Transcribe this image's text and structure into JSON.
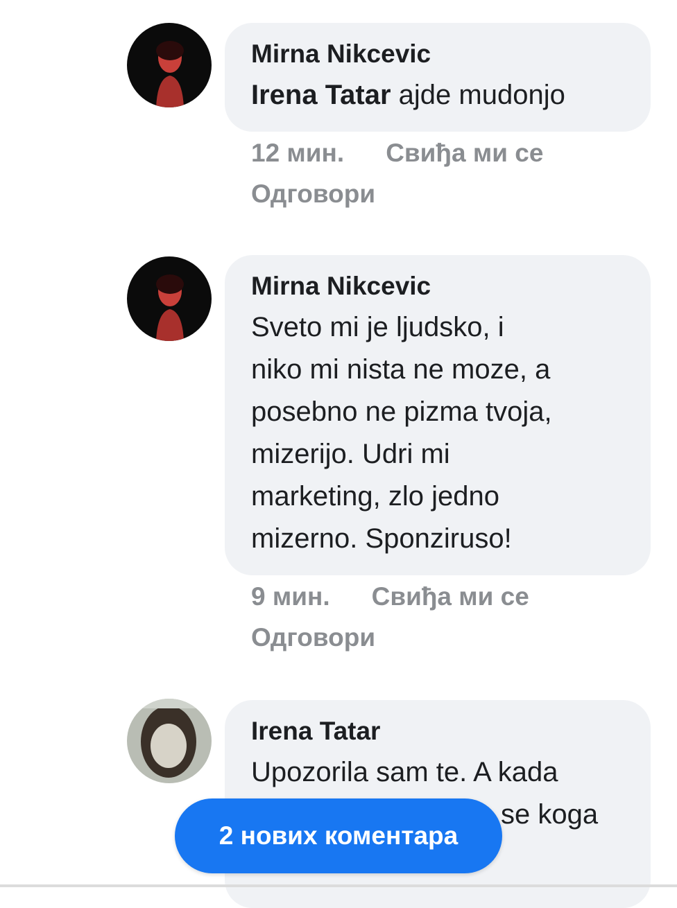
{
  "comments": [
    {
      "author": "Mirna Nikcevic",
      "mention": "Irena Tatar",
      "text": " ajde mudonjo",
      "time": "12 мин.",
      "like": "Свиђа ми се",
      "reply": "Одговори"
    },
    {
      "author": "Mirna Nikcevic",
      "text_lines": [
        "Sveto mi je ljudsko, i",
        "niko mi nista ne moze, a",
        "posebno ne pizma tvoja,",
        "mizerijo. Udri mi",
        "marketing, zlo jedno",
        "mizerno. Sponziruso!"
      ],
      "time": "9 мин.",
      "like": "Свиђа ми се",
      "reply": "Одговори"
    },
    {
      "author": "Irena Tatar",
      "text_lines": [
        "Upozorila sam te. A kada",
        "se koga"
      ]
    }
  ],
  "new_comments_button": "2 нових коментара",
  "colors": {
    "bubble": "#f0f2f5",
    "meta": "#8a8d91",
    "button": "#1877f2"
  }
}
